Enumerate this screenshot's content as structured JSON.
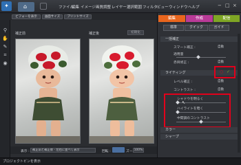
{
  "menu": {
    "items": [
      "ファイル",
      "編集",
      "イメージ",
      "画質調整",
      "レイヤー",
      "選択範囲",
      "フィルタ",
      "ビュー",
      "ウィンドウ",
      "ヘルプ"
    ],
    "home_icon": "home-icon"
  },
  "toolbar": {
    "view_fit": "ビフォーを表示",
    "view_screen": "画面サイズ",
    "view_print": "プリントサイズ"
  },
  "canvas": {
    "before_label": "補正前",
    "after_label": "補正後",
    "reset_label": "初期化"
  },
  "bottom": {
    "show_label": "表示 :",
    "show_value": "補正前と補正後 - 左右に並べて表示",
    "rotate_label": "回転 :",
    "zoom_label": "ズーム :",
    "zoom_value": "100%"
  },
  "status": {
    "text": "プロジェクトビンを表示"
  },
  "panel": {
    "mode_tabs": [
      {
        "label": "編集",
        "color": "#e9651d"
      },
      {
        "label": "作成",
        "color": "#b93a97"
      },
      {
        "label": "配信",
        "color": "#7ea524"
      }
    ],
    "sub_tabs": [
      "標準",
      "クイック",
      "ガイド"
    ],
    "sections": {
      "general": {
        "title": "一括補正",
        "rows": [
          {
            "label": "スマート補正 :",
            "value": "自動"
          },
          {
            "label": "適用量",
            "value": ""
          },
          {
            "label": "赤目修正 :",
            "value": "自動"
          }
        ]
      },
      "lighting": {
        "title": "ライティング",
        "rows": [
          {
            "label": "レベル補正 :",
            "value": "自動"
          },
          {
            "label": "コントラスト :",
            "value": "自動"
          }
        ],
        "sliders": [
          "シャドウを明るく",
          "ハイライトを暗く",
          "中間調のコントラスト"
        ]
      },
      "color": {
        "title": "カラー"
      },
      "sharpen": {
        "title": "シャープ"
      }
    }
  },
  "colors": {
    "accent_red": "#e3001b",
    "edit_tab": "#e9651d",
    "create_tab": "#b93a97",
    "share_tab": "#7ea524"
  }
}
